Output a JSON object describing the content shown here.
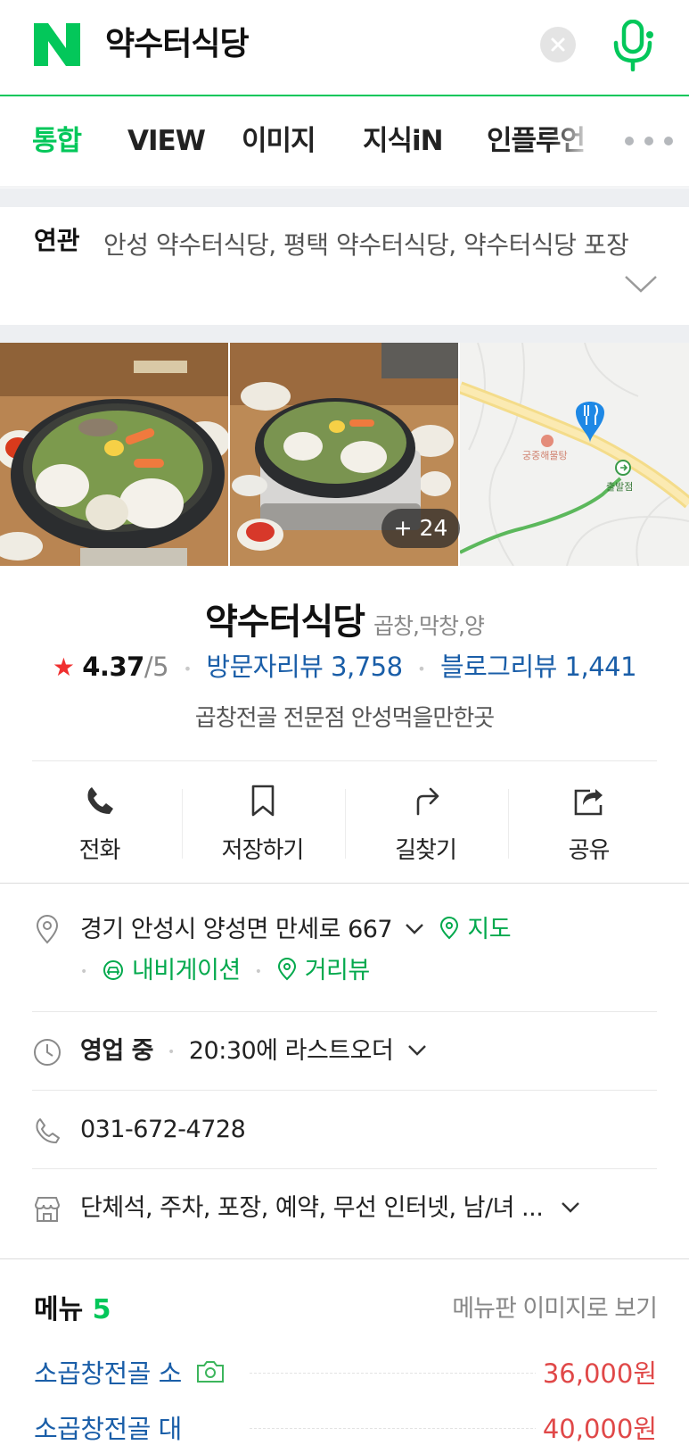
{
  "search": {
    "query": "약수터식당",
    "brand_color": "#03c75a"
  },
  "tabs": [
    {
      "label": "통합",
      "active": true
    },
    {
      "label": "VIEW"
    },
    {
      "label": "이미지"
    },
    {
      "label": "지식iN"
    },
    {
      "label": "인플루언"
    }
  ],
  "related": {
    "label": "연관",
    "keywords_text": "안성 약수터식당, 평택 약수터식당, 약수터식당 포장"
  },
  "photos": {
    "more_count_label": "+ 24",
    "map_labels": {
      "place": "궁중해물탕",
      "start": "출발점"
    }
  },
  "place": {
    "name": "약수터식당",
    "category": "곱창,막창,양",
    "rating": "4.37",
    "rating_max": "/5",
    "visitor_reviews": "방문자리뷰 3,758",
    "blog_reviews": "블로그리뷰 1,441",
    "description": "곱창전골 전문점 안성먹을만한곳"
  },
  "actions": [
    {
      "label": "전화",
      "icon": "phone-icon"
    },
    {
      "label": "저장하기",
      "icon": "bookmark-icon"
    },
    {
      "label": "길찾기",
      "icon": "directions-icon"
    },
    {
      "label": "공유",
      "icon": "share-icon"
    }
  ],
  "details": {
    "address": "경기 안성시 양성면 만세로 667",
    "map_link": "지도",
    "navigation_link": "내비게이션",
    "streetview_link": "거리뷰",
    "hours_status": "영업 중",
    "hours_detail": "20:30에 라스트오더",
    "phone": "031-672-4728",
    "amenities": "단체석, 주차, 포장, 예약, 무선 인터넷, 남/녀 ..."
  },
  "menu": {
    "title": "메뉴",
    "count": "5",
    "board_link": "메뉴판 이미지로 보기",
    "items": [
      {
        "name": "소곱창전골 소",
        "price": "36,000원"
      },
      {
        "name": "소곱창전골 대",
        "price": "40,000원"
      }
    ]
  },
  "colors": {
    "link_blue": "#1a5ea8",
    "price_red": "#e04848",
    "star_red": "#f02f2f",
    "green_link": "#03a94d"
  }
}
